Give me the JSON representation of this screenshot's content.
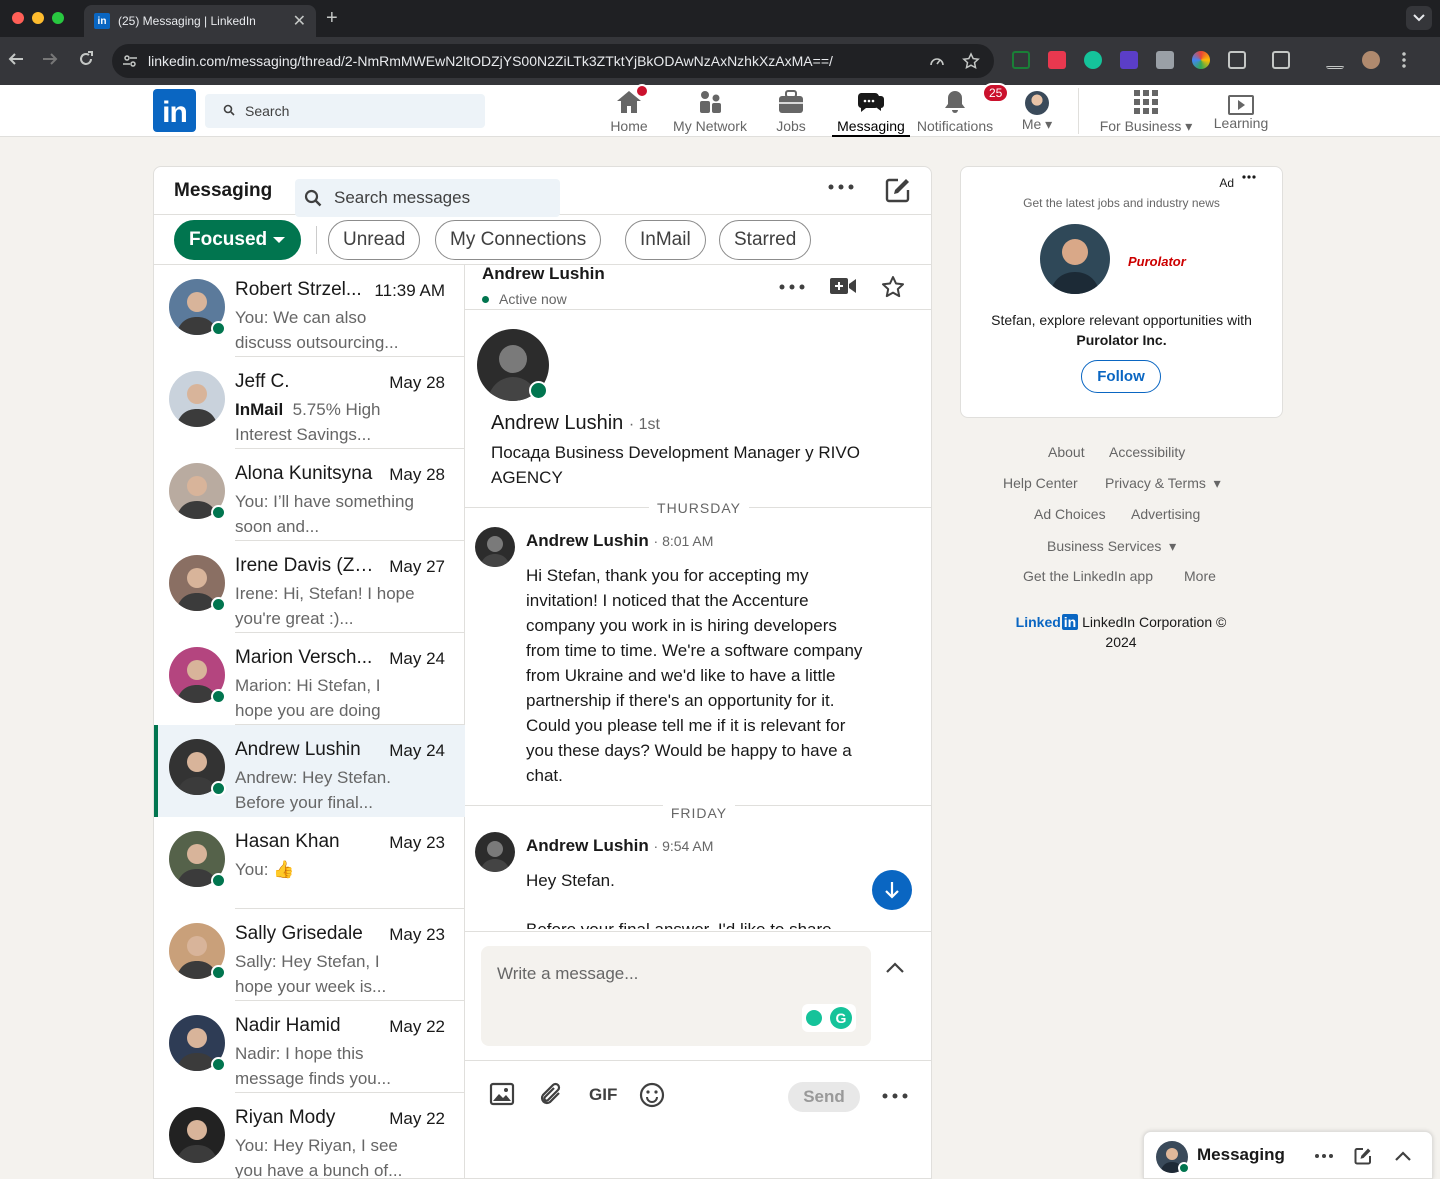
{
  "browser": {
    "tab_title": "(25) Messaging | LinkedIn",
    "url": "linkedin.com/messaging/thread/2-NmRmMWEwN2ltODZjYS00N2ZiLTk3ZTktYjBkODAwNzAxNzhkXzAxMA==/"
  },
  "linkedin_nav": {
    "search_placeholder": "Search",
    "items": {
      "home": "Home",
      "network": "My Network",
      "jobs": "Jobs",
      "messaging": "Messaging",
      "notifications": "Notifications",
      "notifications_badge": "25",
      "me": "Me",
      "business": "For Business",
      "learning": "Learning"
    }
  },
  "messaging": {
    "title": "Messaging",
    "search_placeholder": "Search messages",
    "filters": [
      "Focused",
      "Unread",
      "My Connections",
      "InMail",
      "Starred"
    ],
    "conversations": [
      {
        "name": "Robert Strzel...",
        "date": "11:39 AM",
        "preview": "You: We can also discuss outsourcing...",
        "tag": "",
        "online": true
      },
      {
        "name": "Jeff C.",
        "date": "May 28",
        "preview": "5.75% High Interest Savings...",
        "tag": "InMail",
        "online": false
      },
      {
        "name": "Alona Kunitsyna",
        "date": "May 28",
        "preview": "You: I’ll have something soon and...",
        "tag": "",
        "online": true
      },
      {
        "name": "Irene Davis (Zh...",
        "date": "May 27",
        "preview": "Irene: Hi, Stefan! I hope you're great :)...",
        "tag": "",
        "online": true
      },
      {
        "name": "Marion Versch...",
        "date": "May 24",
        "preview": "Marion: Hi Stefan, I hope you are doing well. I...",
        "tag": "",
        "online": true
      },
      {
        "name": "Andrew Lushin",
        "date": "May 24",
        "preview": "Andrew: Hey Stefan. Before your final...",
        "tag": "",
        "online": true
      },
      {
        "name": "Hasan Khan",
        "date": "May 23",
        "preview": "You: 👍",
        "tag": "",
        "online": true
      },
      {
        "name": "Sally Grisedale",
        "date": "May 23",
        "preview": "Sally: Hey Stefan, I hope your week is...",
        "tag": "",
        "online": true
      },
      {
        "name": "Nadir Hamid",
        "date": "May 22",
        "preview": "Nadir: I hope this message finds you...",
        "tag": "",
        "online": true
      },
      {
        "name": "Riyan Mody",
        "date": "May 22",
        "preview": "You: Hey Riyan, I see you have a bunch of...",
        "tag": "",
        "online": false
      }
    ]
  },
  "thread": {
    "name": "Andrew Lushin",
    "status": "Active now",
    "profile_name": "Andrew Lushin",
    "degree": "· 1st",
    "headline": "Посада Business Development Manager у RIVO AGENCY",
    "day1": "THURSDAY",
    "day2": "FRIDAY",
    "msg1": {
      "sender": "Andrew Lushin",
      "time": "· 8:01 AM",
      "body": "Hi Stefan, thank you for accepting my invitation! I noticed that the Accenture company you work in is hiring developers from time to time. We're a software company from Ukraine and we'd like to have a little partnership if there's an opportunity for it. Could you please tell me if it is relevant for you these days? Would be happy to have a chat."
    },
    "msg2": {
      "sender": "Andrew Lushin",
      "time": "· 9:54 AM",
      "body": "Hey Stefan.",
      "body2": "Before your final answer, I'd like to share"
    },
    "composer_placeholder": "Write a message...",
    "gif_label": "GIF",
    "send_label": "Send"
  },
  "ad": {
    "label": "Ad",
    "tagline": "Get the latest jobs and industry news",
    "company_logo_text": "Purolator",
    "text": "Stefan, explore relevant opportunities with",
    "company": "Purolator Inc.",
    "follow": "Follow"
  },
  "footer": {
    "about": "About",
    "accessibility": "Accessibility",
    "help": "Help Center",
    "privacy": "Privacy & Terms",
    "adchoices": "Ad Choices",
    "advertising": "Advertising",
    "business": "Business Services",
    "app": "Get the LinkedIn app",
    "more": "More",
    "logo_text": "Linked",
    "logo_in": "in",
    "corp": "LinkedIn Corporation © 2024"
  },
  "mini_messaging": {
    "label": "Messaging"
  }
}
